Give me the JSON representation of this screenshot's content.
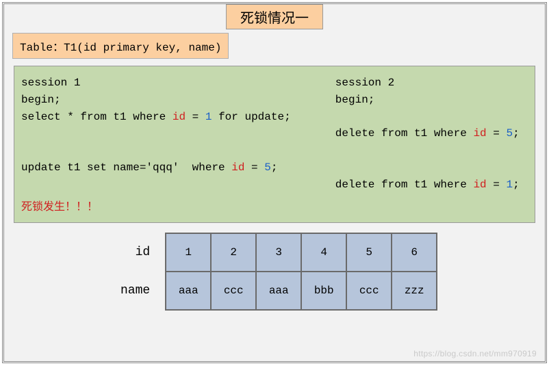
{
  "title": "死锁情况一",
  "table_def": "Table：T1(id primary key, name)",
  "session1": {
    "header": "session 1",
    "l1": "begin;",
    "l2a": "select * from t1 where ",
    "l2b": " = ",
    "l2c": " for update;",
    "l3a": "update t1 set name='qqq'  where ",
    "l3b": " = ",
    "l3c": ";",
    "id_kw": "id",
    "val1": "1",
    "val5": "5"
  },
  "session2": {
    "header": "session 2",
    "l1": "begin;",
    "l2a": "delete from t1 where ",
    "l2b": " = ",
    "l2c": ";",
    "l3a": "delete from t1 where ",
    "l3b": " = ",
    "l3c": ";",
    "id_kw": "id",
    "val5": "5",
    "val1": "1"
  },
  "deadlock": "死锁发生！！！",
  "table": {
    "row1_label": "id",
    "row2_label": "name",
    "ids": [
      "1",
      "2",
      "3",
      "4",
      "5",
      "6"
    ],
    "names": [
      "aaa",
      "ccc",
      "aaa",
      "bbb",
      "ccc",
      "zzz"
    ]
  },
  "watermark": "https://blog.csdn.net/mm970919"
}
